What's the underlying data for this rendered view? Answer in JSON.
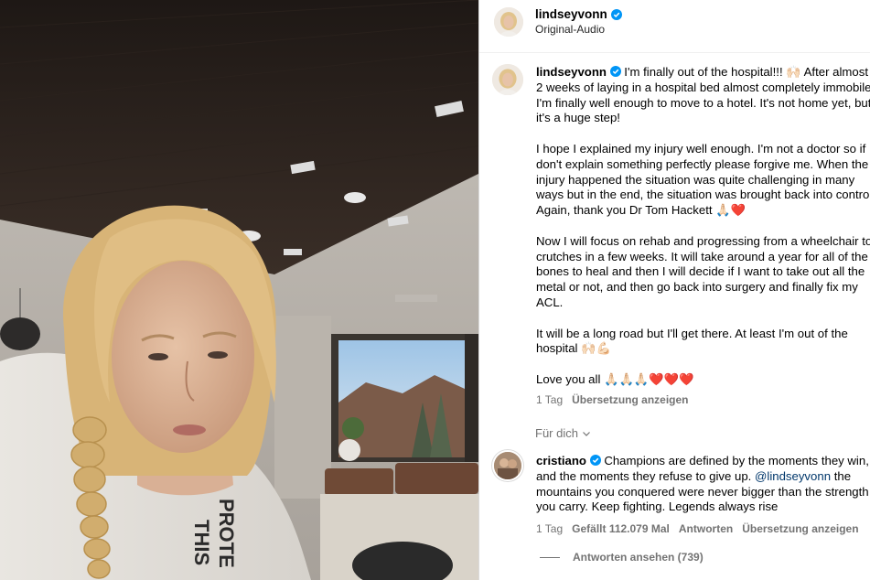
{
  "header": {
    "username": "lindseyvonn",
    "audio": "Original-Audio"
  },
  "post": {
    "username": "lindseyvonn",
    "paragraphs": [
      "I'm finally out of the hospital!!! 🙌🏻 After almost 2 weeks of laying in a hospital bed almost completely immobile, I'm finally well enough to move to a hotel. It's not home yet, but it's a huge step!",
      "I hope I explained my injury well enough. I'm not a doctor so if I don't explain something perfectly please forgive me. When the injury happened the situation was quite challenging in many ways but in the end, the situation was brought back into control. Again, thank you Dr Tom Hackett 🙏🏻❤️",
      "Now I will focus on rehab and progressing from a wheelchair to crutches in a few weeks. It will take around a year for all of the bones to heal and then I will decide if I want to take out all the metal or not, and then go back into surgery and finally fix my ACL.",
      "It will be a long road but I'll get there. At least I'm out of the hospital 🙌🏻💪🏻",
      "Love you all 🙏🏻🙏🏻🙏🏻❤️❤️❤️"
    ],
    "time": "1 Tag",
    "translate": "Übersetzung anzeigen"
  },
  "for_you": "Für dich",
  "comment": {
    "username": "cristiano",
    "text_before": "Champions are defined by the moments they win, and the moments they refuse to give up.",
    "mention": "@lindseyvonn",
    "text_after": "the mountains you conquered were never bigger than the strength you carry. Keep fighting. Legends always rise",
    "time": "1 Tag",
    "likes": "Gefällt 112.079 Mal",
    "reply": "Antworten",
    "translate": "Übersetzung anzeigen",
    "view_replies": "Antworten ansehen (739)"
  },
  "colors": {
    "accent_blue": "#0095f6",
    "verified": "#0095f6",
    "secondary_text": "#737373",
    "mention": "#00376b"
  }
}
